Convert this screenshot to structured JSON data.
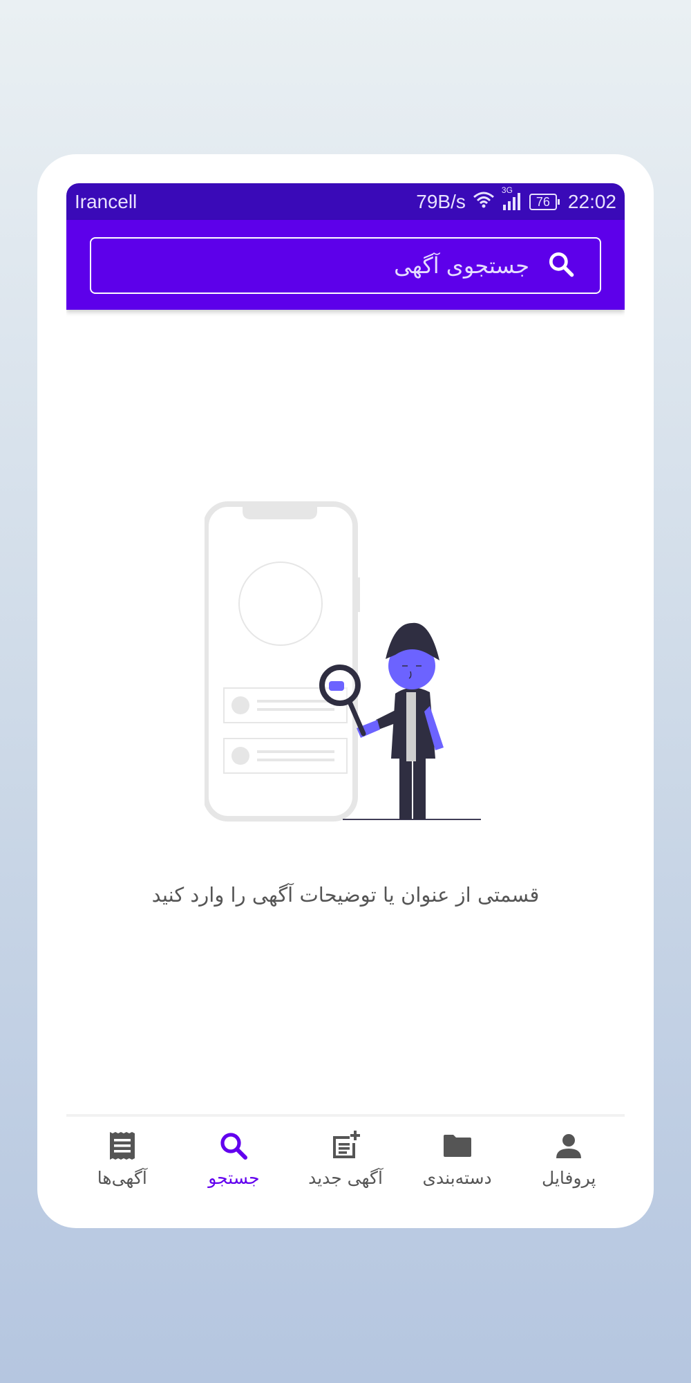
{
  "statusbar": {
    "carrier": "Irancell",
    "speed": "79B/s",
    "network": "3G",
    "battery": "76",
    "time": "22:02"
  },
  "search": {
    "placeholder": "جستجوی آگهی",
    "icon": "search-icon"
  },
  "empty_state": {
    "illustration": "person-with-magnifier-and-phone",
    "hint": "قسمتی از عنوان یا توضیحات آگهی را وارد کنید"
  },
  "bottom_nav": {
    "items": [
      {
        "label": "آگهی‌ها",
        "icon": "list-icon"
      },
      {
        "label": "جستجو",
        "icon": "search-icon",
        "active": true
      },
      {
        "label": "آگهی جدید",
        "icon": "new-post-icon"
      },
      {
        "label": "دسته‌بندی",
        "icon": "folder-icon"
      },
      {
        "label": "پروفایل",
        "icon": "person-icon"
      }
    ]
  },
  "colors": {
    "statusbar": "#3a0ab8",
    "appbar": "#5d00ea",
    "active": "#6200ee",
    "inactive": "#555555"
  }
}
